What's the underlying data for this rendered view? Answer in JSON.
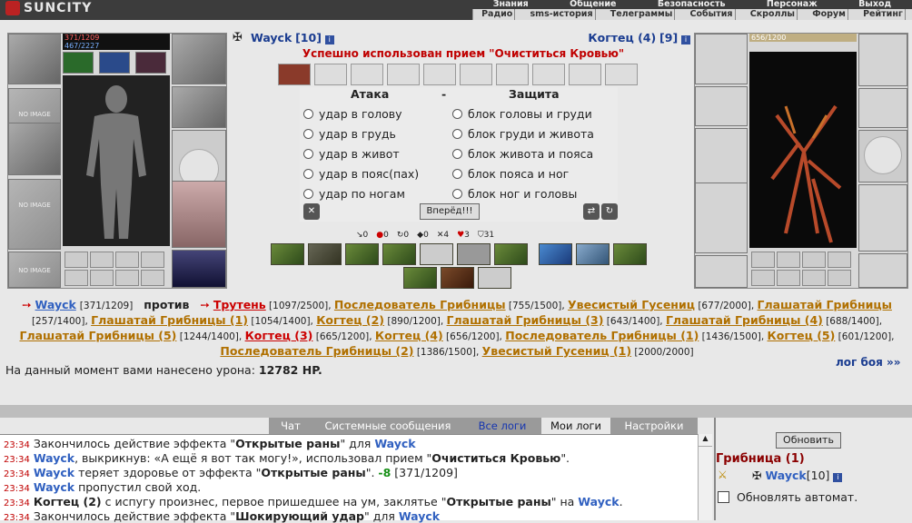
{
  "app": {
    "logo": "SUNCITY"
  },
  "menu": {
    "top": [
      "Знания",
      "Общение",
      "Безопасность",
      "Персонаж",
      "Выход"
    ],
    "sub": [
      "Радио",
      "sms-история",
      "Телеграммы",
      "События",
      "Скроллы",
      "Форум",
      "Рейтинг"
    ]
  },
  "player": {
    "name": "Wayck",
    "level": "[10]",
    "hp": "371/1209",
    "mana": "467/2227",
    "no_image": "NO IMAGE"
  },
  "enemy": {
    "name": "Когтец (4)",
    "level": "[9]",
    "hp": "656/1200"
  },
  "status": "Успешно использован прием \"Очиститься Кровью\"",
  "fight": {
    "attack_header": "Атака",
    "defense_header": "Защита",
    "sep": "-",
    "attacks": [
      "удар в голову",
      "удар в грудь",
      "удар в живот",
      "удар в пояс(пах)",
      "удар по ногам"
    ],
    "defenses": [
      "блок головы и груди",
      "блок груди и живота",
      "блок живота и пояса",
      "блок пояса и ног",
      "блок ног и головы"
    ],
    "go_button": "Вперёд!!!"
  },
  "stats": [
    "0",
    "0",
    "0",
    "0",
    "4",
    "3",
    "31"
  ],
  "enemies_line": [
    {
      "n": "Трутень",
      "h": "[1097/2500]",
      "c": "red"
    },
    {
      "n": "Последователь Грибницы",
      "h": "[755/1500]"
    },
    {
      "n": "Увесистый Гусениц",
      "h": "[677/2000]"
    },
    {
      "n": "Глашатай Грибницы",
      "h": "[257/1400]"
    },
    {
      "n": "Глашатай Грибницы (1)",
      "h": "[1054/1400]"
    },
    {
      "n": "Когтец (2)",
      "h": "[890/1200]"
    },
    {
      "n": "Глашатай Грибницы (3)",
      "h": "[643/1400]"
    },
    {
      "n": "Глашатай Грибницы (4)",
      "h": "[688/1400]"
    },
    {
      "n": "Глашатай Грибницы (5)",
      "h": "[1244/1400]"
    },
    {
      "n": "Когтец (3)",
      "h": "[665/1200]",
      "c": "red"
    },
    {
      "n": "Когтец (4)",
      "h": "[656/1200]"
    },
    {
      "n": "Последователь Грибницы (1)",
      "h": "[1436/1500]"
    },
    {
      "n": "Когтец (5)",
      "h": "[601/1200]"
    },
    {
      "n": "Последователь Грибницы (2)",
      "h": "[1386/1500]"
    },
    {
      "n": "Увесистый Гусениц (1)",
      "h": "[2000/2000]"
    }
  ],
  "versus": {
    "self": "Wayck",
    "self_hp": "[371/1209]",
    "word": "против"
  },
  "damage": {
    "text": "На данный момент вами нанесено урона:",
    "value": "12782 HP."
  },
  "battle_log_link": "лог боя »»",
  "chat_tabs": [
    "Чат",
    "Системные сообщения",
    "Все логи",
    "Мои логи",
    "Настройки"
  ],
  "chat_lines": [
    {
      "t": "23:34",
      "parts": [
        [
          "Закончилось действие эффекта \"",
          ""
        ],
        [
          "Открытые раны",
          "wh"
        ],
        [
          "\" для ",
          ""
        ],
        [
          "Wayck",
          "who"
        ]
      ]
    },
    {
      "t": "23:34",
      "parts": [
        [
          "Wayck",
          "who"
        ],
        [
          ", выкрикнув: «А ещё я вот так могу!», использовал прием \"",
          ""
        ],
        [
          "Очиститься Кровью",
          "wh"
        ],
        [
          "\".",
          ""
        ]
      ]
    },
    {
      "t": "23:34",
      "parts": [
        [
          "Wayck",
          "who"
        ],
        [
          " теряет здоровье от эффекта \"",
          ""
        ],
        [
          "Открытые раны",
          "wh"
        ],
        [
          "\". ",
          ""
        ],
        [
          "-8",
          "grn"
        ],
        [
          " [371/1209]",
          ""
        ]
      ]
    },
    {
      "t": "23:34",
      "parts": [
        [
          "Wayck",
          "who"
        ],
        [
          " пропустил свой ход.",
          ""
        ]
      ]
    },
    {
      "t": "23:34",
      "parts": [
        [
          "Когтец (2)",
          "wh"
        ],
        [
          " с испугу произнес, первое пришедшее на ум, заклятье \"",
          ""
        ],
        [
          "Открытые раны",
          "wh"
        ],
        [
          "\" на ",
          ""
        ],
        [
          "Wayck",
          "who"
        ],
        [
          ".",
          ""
        ]
      ]
    },
    {
      "t": "23:34",
      "parts": [
        [
          "Закончилось действие эффекта \"",
          ""
        ],
        [
          "Шокирующий удар",
          "wh"
        ],
        [
          "\" для ",
          ""
        ],
        [
          "Wayck",
          "who"
        ]
      ]
    }
  ],
  "right": {
    "refresh": "Обновить",
    "group": "Грибница (1)",
    "member": "Wayck",
    "member_level": "[10]",
    "auto": "Обновлять автомат."
  }
}
